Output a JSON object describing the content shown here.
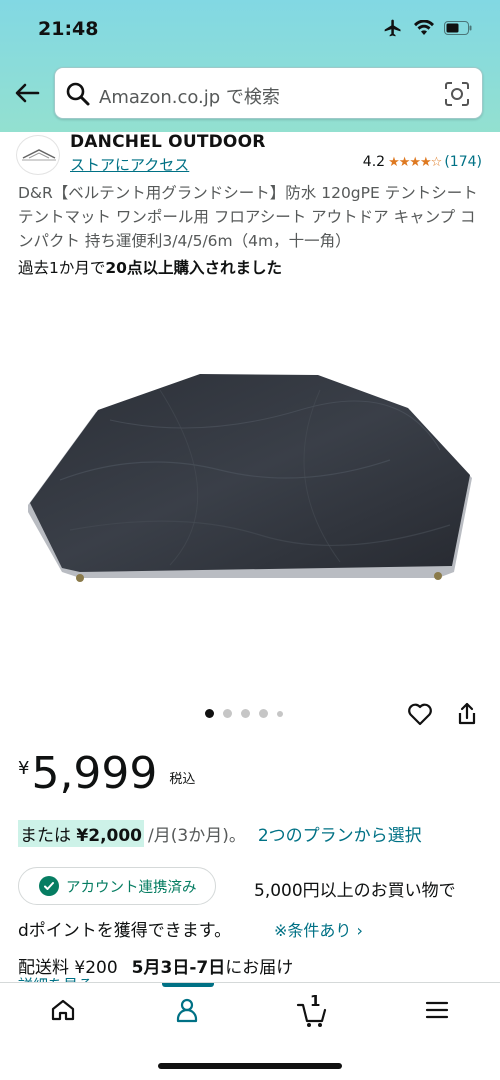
{
  "status_bar": {
    "time": "21:48"
  },
  "search": {
    "placeholder": "Amazon.co.jp で検索"
  },
  "brand": {
    "logo_text": "DANCHEL OUTDOOR",
    "name": "DANCHEL OUTDOOR",
    "store_link": "ストアにアクセス"
  },
  "rating": {
    "value": "4.2",
    "stars": "★★★★☆",
    "count": "(174)",
    "score": 4.2
  },
  "product": {
    "title": "D&R【ベルテント用グランドシート】防水 120gPE テントシート テントマット ワンポール用 フロアシート アウトドア キャンプ コンパクト 持ち運便利3/4/5/6m（4m，十一角）",
    "bought_prefix": "過去1か月で",
    "bought_bold": "20点以上購入されました"
  },
  "gallery": {
    "image_count": 5,
    "active_index": 0
  },
  "price": {
    "currency": "¥",
    "value": "5,999",
    "tax_label": "税込"
  },
  "installment": {
    "prefix": "または",
    "amount": "¥2,000",
    "per_month": "/月(3か月)。",
    "plan_link": "2つのプランから選択"
  },
  "points": {
    "account_badge": "アカウント連携済み",
    "text1": "5,000円以上のお買い物で",
    "text2": "dポイントを獲得できます。",
    "conditions_link": "※条件あり ›"
  },
  "delivery": {
    "label": "配送料 ¥200",
    "date": "5月3日-7日",
    "suffix": "にお届け",
    "details": "詳細を見る"
  },
  "bottom_nav": {
    "items": [
      "home-icon",
      "account-icon",
      "cart-icon",
      "menu-icon"
    ],
    "cart_count": "1",
    "active": "account-icon"
  },
  "colors": {
    "header_gradient_top": "#82d8e3",
    "header_gradient_bottom": "#93e0d0",
    "link": "#007185",
    "star": "#de7921",
    "green": "#067d62",
    "installment_highlight": "#cdf2e8"
  }
}
